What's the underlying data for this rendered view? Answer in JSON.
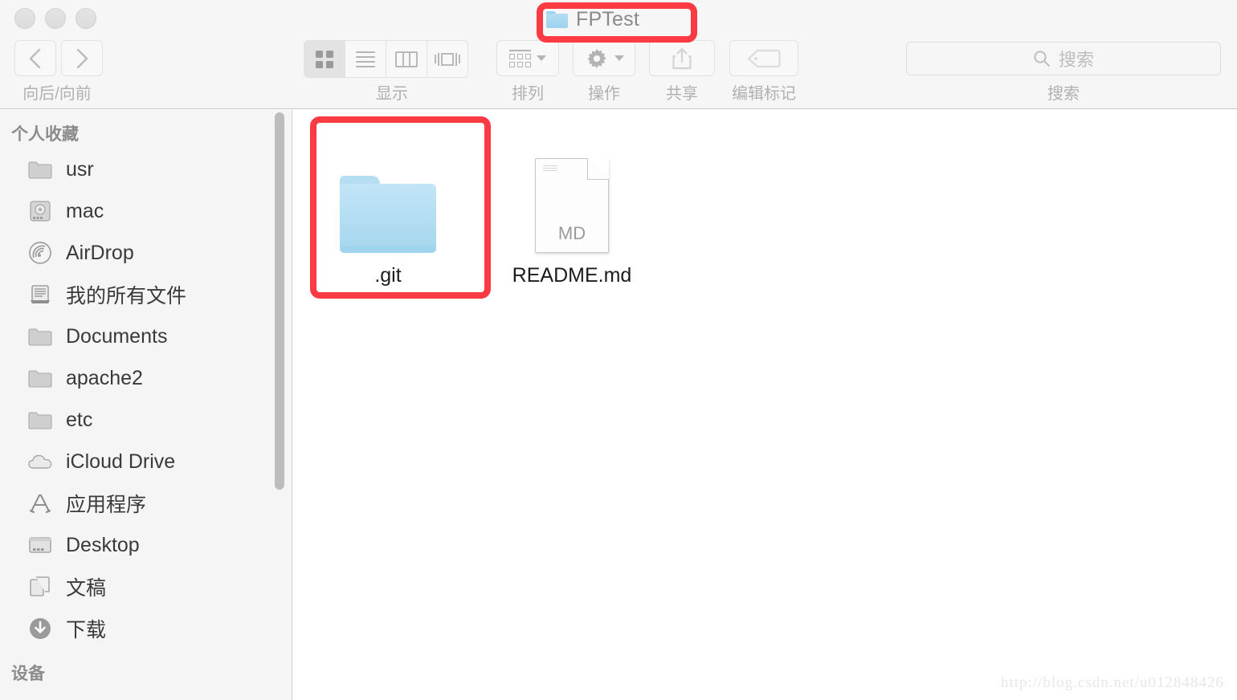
{
  "window": {
    "title": "FPTest",
    "title_icon": "folder-icon",
    "traffic_lights": [
      "close-button",
      "minimize-button",
      "zoom-button"
    ]
  },
  "toolbar": {
    "nav": {
      "back_icon": "chevron-left-icon",
      "forward_icon": "chevron-right-icon",
      "caption": "向后/向前"
    },
    "view": {
      "caption": "显示",
      "modes": [
        {
          "name": "icon-view",
          "icon": "grid-dots-icon",
          "active": true
        },
        {
          "name": "list-view",
          "icon": "list-lines-icon",
          "active": false
        },
        {
          "name": "column-view",
          "icon": "columns-icon",
          "active": false
        },
        {
          "name": "coverflow-view",
          "icon": "coverflow-icon",
          "active": false
        }
      ]
    },
    "arrange": {
      "caption": "排列",
      "icon": "arrange-grid-icon",
      "chevron": "chevron-down-icon"
    },
    "action": {
      "caption": "操作",
      "icon": "gear-icon",
      "chevron": "chevron-down-icon"
    },
    "share": {
      "caption": "共享",
      "icon": "share-upload-icon",
      "disabled": true
    },
    "tags": {
      "caption": "编辑标记",
      "icon": "tag-icon",
      "disabled": true
    },
    "search": {
      "caption": "搜索",
      "placeholder": "搜索",
      "icon": "search-icon",
      "value": ""
    }
  },
  "sidebar": {
    "sections": [
      {
        "header": "个人收藏",
        "items": [
          {
            "label": "usr",
            "icon": "folder-icon"
          },
          {
            "label": "mac",
            "icon": "hard-drive-icon"
          },
          {
            "label": "AirDrop",
            "icon": "airdrop-icon"
          },
          {
            "label": "我的所有文件",
            "icon": "all-files-icon"
          },
          {
            "label": "Documents",
            "icon": "folder-icon"
          },
          {
            "label": "apache2",
            "icon": "folder-icon"
          },
          {
            "label": "etc",
            "icon": "folder-icon"
          },
          {
            "label": "iCloud Drive",
            "icon": "cloud-icon"
          },
          {
            "label": "应用程序",
            "icon": "applications-icon"
          },
          {
            "label": "Desktop",
            "icon": "desktop-icon"
          },
          {
            "label": "文稿",
            "icon": "documents-icon"
          },
          {
            "label": "下载",
            "icon": "downloads-icon"
          }
        ]
      },
      {
        "header": "设备",
        "items": []
      }
    ]
  },
  "content": {
    "files": [
      {
        "name": ".git",
        "kind": "folder",
        "icon": "folder-icon",
        "highlighted": true
      },
      {
        "name": "README.md",
        "kind": "document",
        "icon": "document-icon",
        "badge": "MD",
        "highlighted": false
      }
    ]
  },
  "annotations": {
    "color": "#fb3b44",
    "boxes": [
      "title-highlight",
      "git-folder-highlight"
    ]
  },
  "watermark": "http://blog.csdn.net/u012848426"
}
